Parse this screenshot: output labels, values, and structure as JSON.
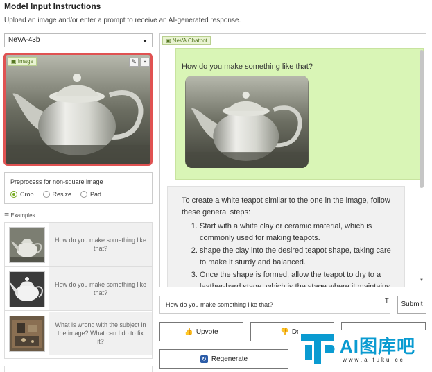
{
  "header": {
    "title": "Model Input Instructions",
    "subtitle": "Upload an image and/or enter a prompt to receive an AI-generated response."
  },
  "model_select": {
    "value": "NeVA-43b"
  },
  "image_panel": {
    "tag": "Image",
    "edit_icon": "pencil-icon",
    "close_icon": "close-icon",
    "close_glyph": "×",
    "edit_glyph": "✎"
  },
  "preprocess": {
    "title": "Preprocess for non-square image",
    "options": [
      "Crop",
      "Resize",
      "Pad"
    ],
    "selected": "Crop"
  },
  "examples": {
    "label": "Examples",
    "items": [
      {
        "text": "How do you make something like that?"
      },
      {
        "text": "How do you make something like that?"
      },
      {
        "text": "What is wrong with the subject in the image? What can I do to fix it?"
      }
    ]
  },
  "chatbot": {
    "tag": "NeVA Chatbot",
    "user_message": "How do you make something like that?",
    "bot_intro": "To create a white teapot similar to the one in the image, follow these general steps:",
    "bot_steps": [
      "Start with a white clay or ceramic material, which is commonly used for making teapots.",
      "shape the clay into the desired teapot shape, taking care to make it sturdy and balanced.",
      "Once the shape is formed, allow the teapot to dry to a leather-hard stage, which is the stage where it maintains"
    ]
  },
  "prompt": {
    "value": "How do you make something like that?"
  },
  "buttons": {
    "submit": "Submit",
    "upvote": "Upvote",
    "downvote": "Dov",
    "regenerate": "Regenerate"
  },
  "watermark": {
    "text": "AI图库吧",
    "url": "www.aituku.cc"
  },
  "colors": {
    "accent": "#77aa22",
    "user_bubble": "#d9f5b6",
    "highlight_border": "#e05252",
    "brand": "#0a9bd1"
  }
}
